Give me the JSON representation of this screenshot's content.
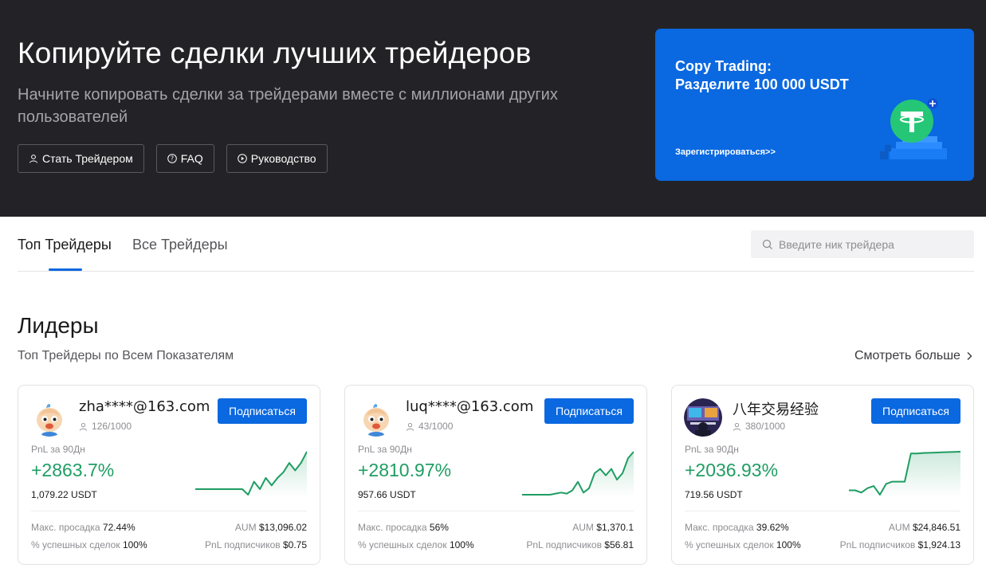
{
  "hero": {
    "title": "Копируйте сделки лучших трейдеров",
    "subtitle": "Начните копировать сделки за трейдерами вместе с миллионами других пользователей",
    "buttons": [
      {
        "label": "Стать Трейдером",
        "icon": "user-icon"
      },
      {
        "label": "FAQ",
        "icon": "question-circle-icon"
      },
      {
        "label": "Руководство",
        "icon": "play-circle-icon"
      }
    ]
  },
  "banner": {
    "title_line1": "Copy Trading:",
    "title_line2": "Разделите 100 000 USDT",
    "link": "Зарегистрироваться>>",
    "icon": "tether-coin-icon"
  },
  "tabs": [
    {
      "label": "Топ Трейдеры",
      "active": true
    },
    {
      "label": "Все Трейдеры",
      "active": false
    }
  ],
  "search": {
    "placeholder": "Введите ник трейдера",
    "icon": "search-icon"
  },
  "section": {
    "title": "Лидеры",
    "subtitle": "Топ Трейдеры по Всем Показателям",
    "see_more": "Смотреть больше"
  },
  "colors": {
    "accent": "#0a68e0",
    "positive": "#1f9d63",
    "hero_bg": "#232327"
  },
  "traders": [
    {
      "name": "zha****@163.com",
      "followers": "126/1000",
      "subscribe": "Подписаться",
      "pnl_label": "PnL за 90Дн",
      "pnl": "+2863.7%",
      "pnl_usdt": "1,079.22 USDT",
      "drawdown_label": "Макс. просадка",
      "drawdown": "72.44%",
      "win_label": "% успешных сделок",
      "win": "100%",
      "aum_label": "AUM",
      "aum": "$13,096.02",
      "follower_pnl_label": "PnL подписчиков",
      "follower_pnl": "$0.75",
      "avatar": "baby-avatar",
      "chart_data": {
        "type": "line",
        "values": [
          4,
          4,
          4,
          4,
          4,
          4,
          4,
          4,
          4,
          1,
          8,
          4,
          10,
          6,
          10,
          13,
          18,
          14,
          18,
          24
        ]
      }
    },
    {
      "name": "luq****@163.com",
      "followers": "43/1000",
      "subscribe": "Подписаться",
      "pnl_label": "PnL за 90Дн",
      "pnl": "+2810.97%",
      "pnl_usdt": "957.66 USDT",
      "drawdown_label": "Макс. просадка",
      "drawdown": "56%",
      "win_label": "% успешных сделок",
      "win": "100%",
      "aum_label": "AUM",
      "aum": "$1,370.1",
      "follower_pnl_label": "PnL подписчиков",
      "follower_pnl": "$56.81",
      "avatar": "baby-avatar",
      "chart_data": {
        "type": "line",
        "values": [
          2,
          2,
          2,
          2,
          2,
          2,
          2.5,
          3,
          2.5,
          4,
          8,
          3,
          5,
          12,
          14,
          11,
          14,
          9,
          12,
          19,
          22
        ]
      }
    },
    {
      "name": "八年交易经验",
      "followers": "380/1000",
      "subscribe": "Подписаться",
      "pnl_label": "PnL за 90Дн",
      "pnl": "+2036.93%",
      "pnl_usdt": "719.56 USDT",
      "drawdown_label": "Макс. просадка",
      "drawdown": "39.62%",
      "win_label": "% успешных сделок",
      "win": "100%",
      "aum_label": "AUM",
      "aum": "$24,846.51",
      "follower_pnl_label": "PnL подписчиков",
      "follower_pnl": "$1,924.13",
      "avatar": "trader-desk-avatar",
      "chart_data": {
        "type": "line",
        "values": [
          3,
          3,
          2,
          4,
          5,
          1,
          6,
          7,
          7,
          7,
          20,
          20,
          20.2,
          20.3,
          20.4,
          20.5,
          20.6,
          20.7,
          20.8
        ]
      }
    }
  ]
}
